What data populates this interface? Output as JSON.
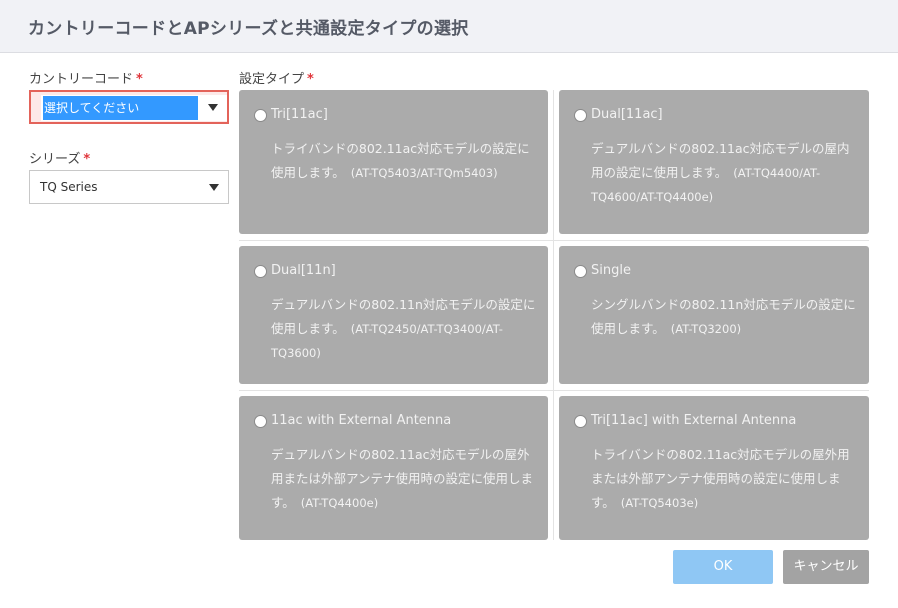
{
  "dialog": {
    "title": "カントリーコードとAPシリーズと共通設定タイプの選択"
  },
  "form": {
    "required_mark": "*",
    "country_code": {
      "label": "カントリーコード",
      "value": "選択してください"
    },
    "series": {
      "label": "シリーズ",
      "value": "TQ Series"
    },
    "setting_type": {
      "label": "設定タイプ",
      "options": [
        {
          "title": "Tri[11ac]",
          "description": "トライバンドの802.11ac対応モデルの設定に使用します。",
          "models": "(AT-TQ5403/AT-TQm5403)"
        },
        {
          "title": "Dual[11ac]",
          "description": "デュアルバンドの802.11ac対応モデルの屋内用の設定に使用します。",
          "models": "(AT-TQ4400/AT-TQ4600/AT-TQ4400e)"
        },
        {
          "title": "Dual[11n]",
          "description": "デュアルバンドの802.11n対応モデルの設定に使用します。",
          "models": "(AT-TQ2450/AT-TQ3400/AT-TQ3600)"
        },
        {
          "title": "Single",
          "description": "シングルバンドの802.11n対応モデルの設定に使用します。",
          "models": "(AT-TQ3200)"
        },
        {
          "title": "11ac with External Antenna",
          "description": "デュアルバンドの802.11ac対応モデルの屋外用または外部アンテナ使用時の設定に使用します。",
          "models": "(AT-TQ4400e)"
        },
        {
          "title": "Tri[11ac] with External Antenna",
          "description": "トライバンドの802.11ac対応モデルの屋外用または外部アンテナ使用時の設定に使用します。",
          "models": "(AT-TQ5403e)"
        }
      ]
    }
  },
  "buttons": {
    "ok_label": "OK",
    "cancel_label": "キャンセル"
  },
  "colors": {
    "required": "#e0353b",
    "select_error_border": "#e3635a",
    "selection_highlight": "#3399ff",
    "card_background": "#ababab",
    "ok_button": "#8fc7f4",
    "cancel_button": "#a3a3a3"
  },
  "icons": {
    "dropdown": "caret-down-icon",
    "option": "radio-icon"
  }
}
